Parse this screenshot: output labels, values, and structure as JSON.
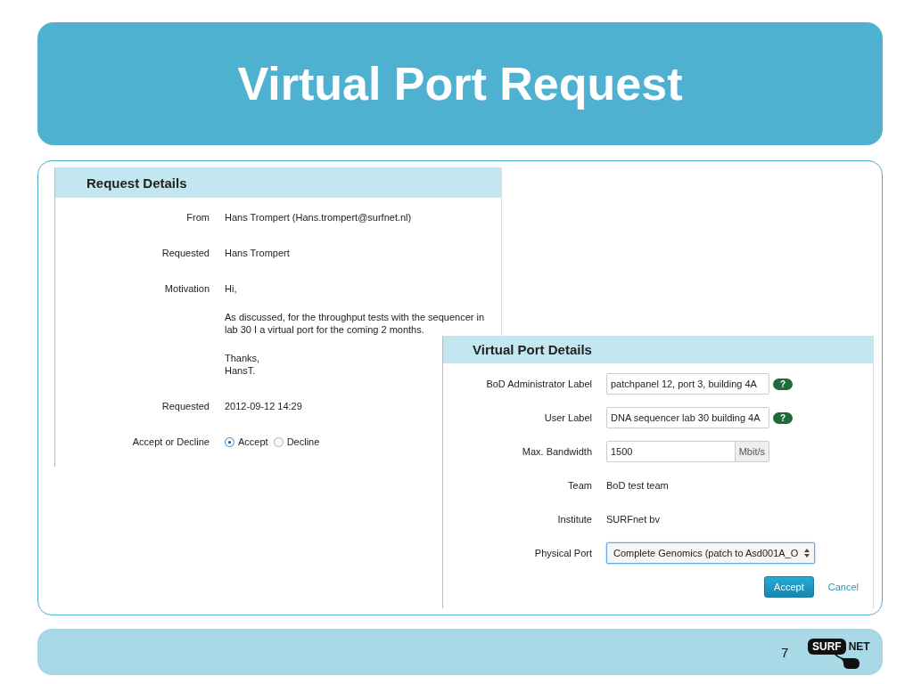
{
  "slide": {
    "title": "Virtual Port Request",
    "page_number": "7",
    "logo": {
      "left": "SURF",
      "right": "NET"
    }
  },
  "request_details": {
    "title": "Request Details",
    "rows": [
      {
        "kind": "text",
        "label": "From",
        "value": "Hans Trompert (Hans.trompert@surfnet.nl)"
      },
      {
        "kind": "text",
        "label": "Requested",
        "value": "Hans Trompert"
      },
      {
        "kind": "paragraphs",
        "label": "Motivation",
        "paragraphs": [
          [
            "Hi,"
          ],
          [
            "As discussed, for the throughput tests with the sequencer in lab 30 I a virtual port for the coming 2 months."
          ],
          [
            "Thanks,",
            "HansT."
          ]
        ]
      },
      {
        "kind": "text",
        "label": "Requested",
        "value": "2012-09-12 14:29"
      },
      {
        "kind": "radio",
        "label": "Accept or Decline",
        "options": [
          {
            "label": "Accept",
            "selected": true
          },
          {
            "label": "Decline",
            "selected": false
          }
        ]
      }
    ]
  },
  "virtual_port_details": {
    "title": "Virtual Port Details",
    "rows": [
      {
        "kind": "input_help",
        "label": "BoD Administrator Label",
        "value": "patchpanel 12, port 3, building 4A",
        "help": "?"
      },
      {
        "kind": "input_help",
        "label": "User Label",
        "value": "DNA sequencer lab 30 building 4A",
        "help": "?"
      },
      {
        "kind": "input_unit",
        "label": "Max. Bandwidth",
        "value": "1500",
        "unit": "Mbit/s"
      },
      {
        "kind": "text",
        "label": "Team",
        "value": "BoD test team"
      },
      {
        "kind": "text",
        "label": "Institute",
        "value": "SURFnet bv"
      },
      {
        "kind": "select",
        "label": "Physical Port",
        "value": "Complete Genomics (patch to Asd001A_O"
      }
    ],
    "buttons": [
      {
        "kind": "primary",
        "label": "Accept"
      },
      {
        "kind": "link",
        "label": "Cancel"
      }
    ]
  }
}
